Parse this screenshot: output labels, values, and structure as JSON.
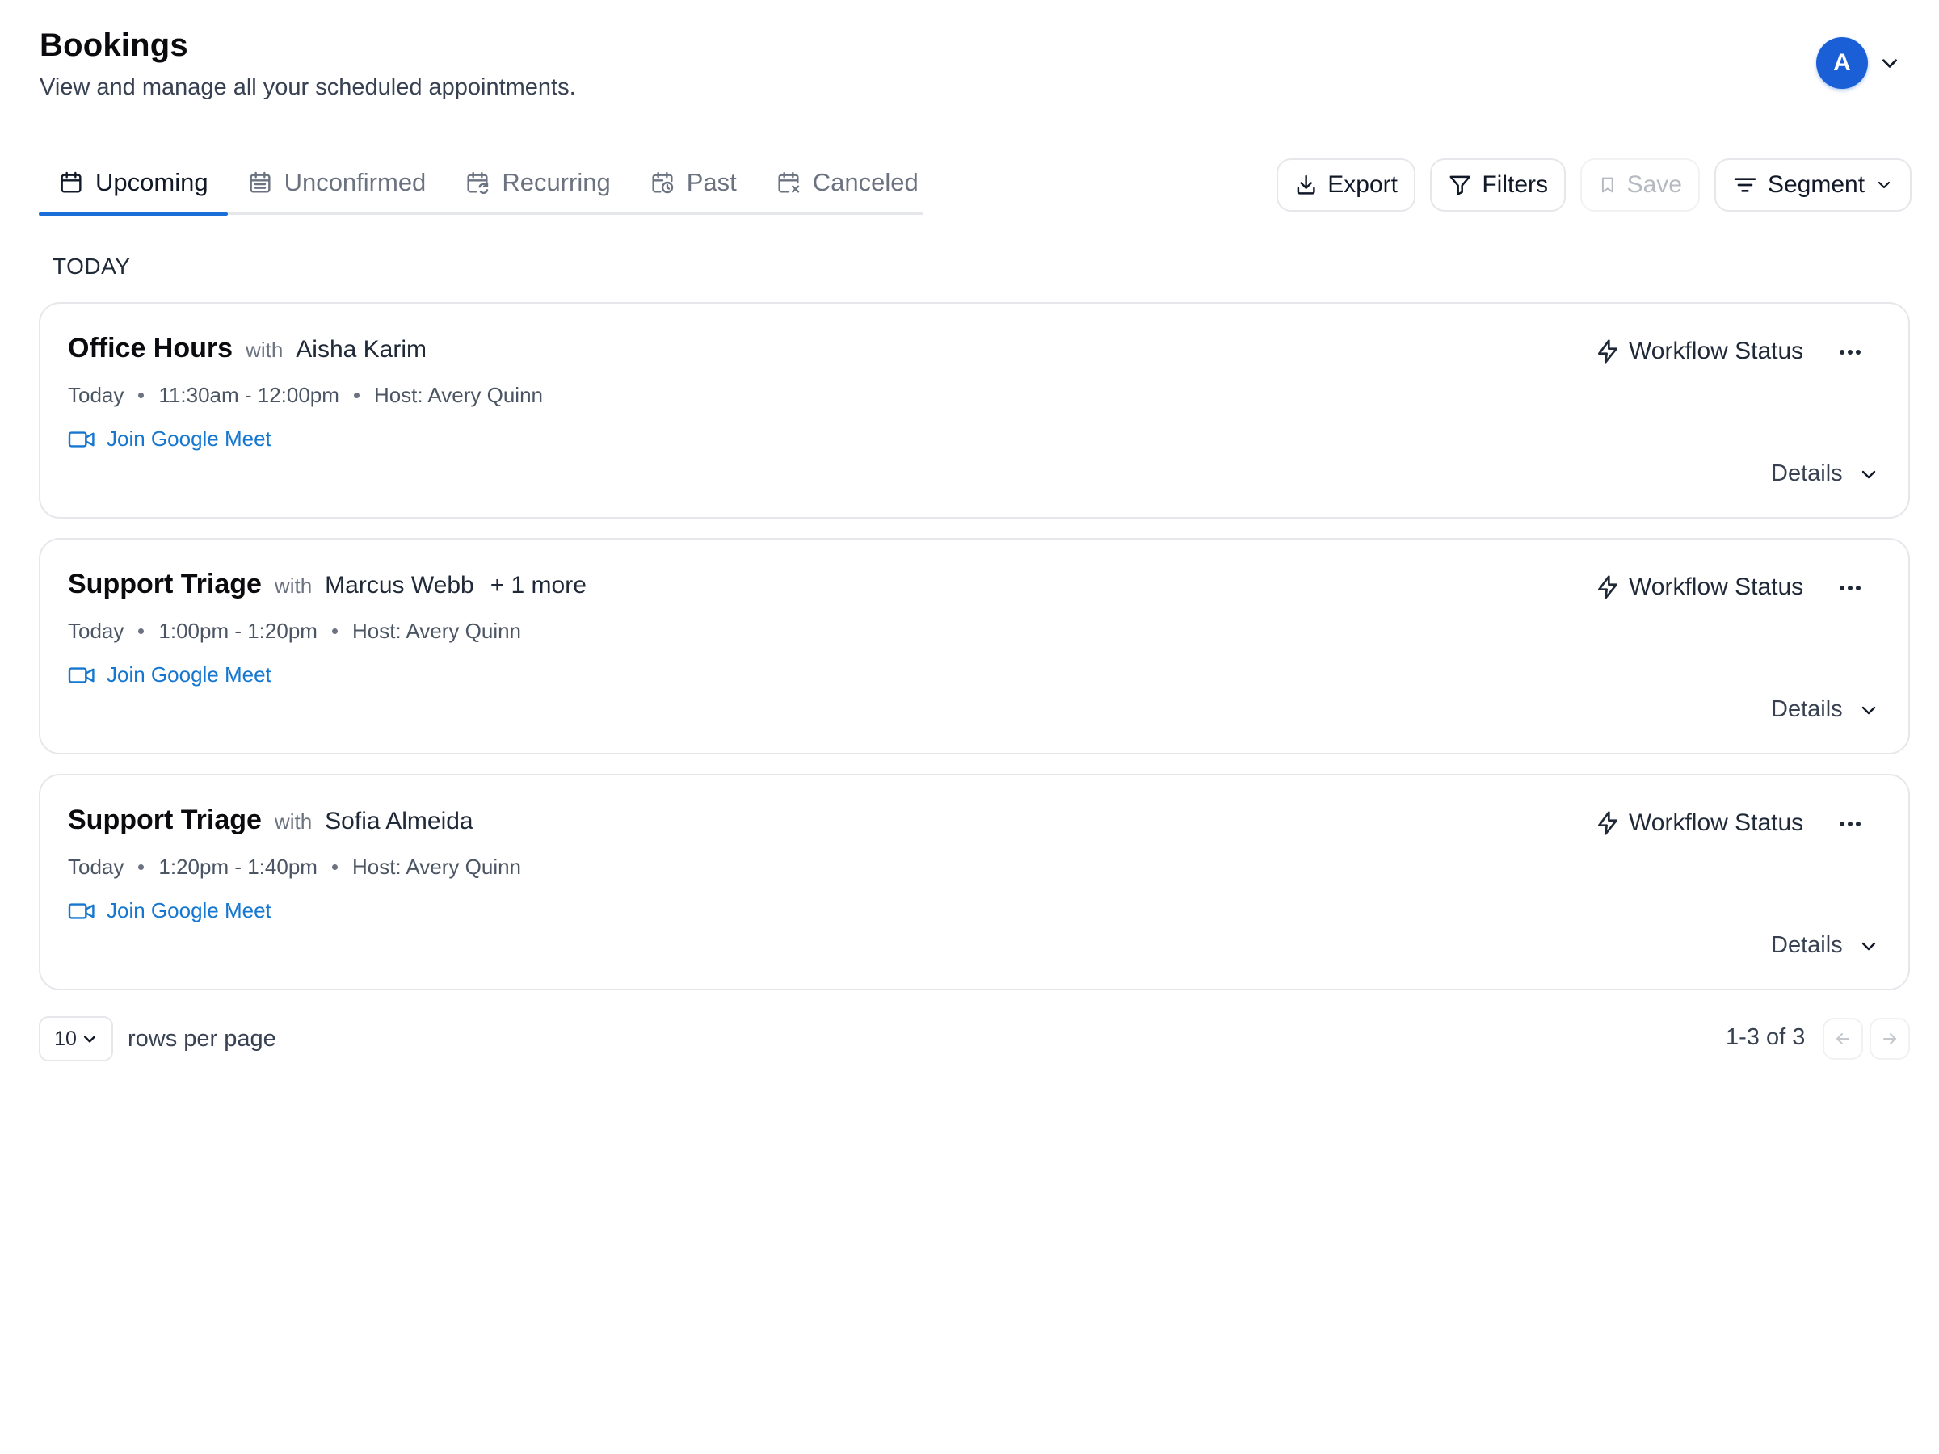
{
  "header": {
    "title": "Bookings",
    "subtitle": "View and manage all your scheduled appointments.",
    "avatar_initial": "A",
    "avatar_color": "#1a5fd6"
  },
  "tabs": [
    {
      "label": "Upcoming",
      "icon": "calendar-icon",
      "active": true
    },
    {
      "label": "Unconfirmed",
      "icon": "calendar-lines-icon",
      "active": false
    },
    {
      "label": "Recurring",
      "icon": "calendar-repeat-icon",
      "active": false
    },
    {
      "label": "Past",
      "icon": "calendar-clock-icon",
      "active": false
    },
    {
      "label": "Canceled",
      "icon": "calendar-x-icon",
      "active": false
    }
  ],
  "toolbar": {
    "export_label": "Export",
    "filters_label": "Filters",
    "save_label": "Save",
    "segment_label": "Segment"
  },
  "section_label": "TODAY",
  "bookings": [
    {
      "title": "Office Hours",
      "with": "with",
      "attendee": "Aisha Karim",
      "more": "",
      "day": "Today",
      "time": "11:30am - 12:00pm",
      "host": "Host: Avery Quinn",
      "meet_label": "Join Google Meet",
      "workflow_label": "Workflow Status",
      "details_label": "Details"
    },
    {
      "title": "Support Triage",
      "with": "with",
      "attendee": "Marcus Webb",
      "more": "+ 1 more",
      "day": "Today",
      "time": "1:00pm - 1:20pm",
      "host": "Host: Avery Quinn",
      "meet_label": "Join Google Meet",
      "workflow_label": "Workflow Status",
      "details_label": "Details"
    },
    {
      "title": "Support Triage",
      "with": "with",
      "attendee": "Sofia Almeida",
      "more": "",
      "day": "Today",
      "time": "1:20pm - 1:40pm",
      "host": "Host: Avery Quinn",
      "meet_label": "Join Google Meet",
      "workflow_label": "Workflow Status",
      "details_label": "Details"
    }
  ],
  "pagination": {
    "rows_value": "10",
    "rows_label": "rows per page",
    "range": "1-3 of 3"
  },
  "colors": {
    "accent": "#1a6ed8",
    "link": "#1577d0",
    "border": "#e5e7eb"
  }
}
